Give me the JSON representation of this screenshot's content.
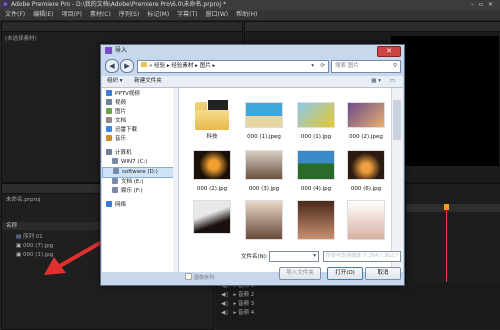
{
  "app": {
    "title": "Adobe Premiere Pro - D:\\我的文档\\Adobe\\Premiere Pro\\6.0\\未命名.prproj *",
    "logo": "Pr",
    "menu": [
      "文件(F)",
      "编辑(E)",
      "项目(P)",
      "素材(C)",
      "序列(S)",
      "标记(M)",
      "字幕(T)",
      "窗口(W)",
      "帮助(H)"
    ]
  },
  "source_panel": {
    "label": "(未选择素材)"
  },
  "project_panel": {
    "project_name": "未命名.prproj",
    "column_header": "名称",
    "items": [
      {
        "name": "序列 01",
        "icon": "sequence-icon"
      },
      {
        "name": "000 (7).jpg",
        "icon": "image-icon"
      },
      {
        "name": "000 (1).jpg",
        "icon": "image-icon"
      }
    ]
  },
  "timeline": {
    "tracks": [
      "音频 1",
      "音频 2",
      "音频 3",
      "音频 4"
    ]
  },
  "import_dialog": {
    "title": "导入",
    "close": "✕",
    "breadcrumb": [
      "«",
      "经验",
      "经验素材",
      "图片"
    ],
    "search_placeholder": "搜索 图片",
    "toolbar": {
      "organize": "组织 ▾",
      "new_folder": "新建文件夹"
    },
    "sidebar": [
      {
        "label": "PPTV视频",
        "color": "#3a7dd8"
      },
      {
        "label": "视频",
        "color": "#6b7f99"
      },
      {
        "label": "图片",
        "color": "#6b9f4a"
      },
      {
        "label": "文档",
        "color": "#8a8a8a"
      },
      {
        "label": "迅雷下载",
        "color": "#3a8ad8"
      },
      {
        "label": "音乐",
        "color": "#d08a2a"
      },
      {
        "label": "计算机",
        "color": "#6b7f99"
      },
      {
        "label": "WIN7 (C:)",
        "color": "#7a8aa8"
      },
      {
        "label": "software (D:)",
        "color": "#7a8aa8"
      },
      {
        "label": "文档 (E:)",
        "color": "#7a8aa8"
      },
      {
        "label": "娱乐 (F:)",
        "color": "#7a8aa8"
      },
      {
        "label": "网络",
        "color": "#3a7dd8"
      }
    ],
    "files": [
      {
        "name": "科技",
        "kind": "folder"
      },
      {
        "name": "000 (1).jpeg",
        "kind": "image",
        "c1": "#3fa6d8",
        "c2": "#e8d6a0"
      },
      {
        "name": "000 (1).jpg",
        "kind": "image",
        "c1": "#8ac8e8",
        "c2": "#e6c830"
      },
      {
        "name": "000 (2).jpeg",
        "kind": "image",
        "c1": "#6a4a8a",
        "c2": "#e8b070"
      },
      {
        "name": "000 (2).jpg",
        "kind": "image",
        "c1": "#1a1008",
        "c2": "#f0a030"
      },
      {
        "name": "000 (3).jpg",
        "kind": "image",
        "c1": "#d8d0c4",
        "c2": "#6a5040"
      },
      {
        "name": "000 (4).jpg",
        "kind": "image",
        "c1": "#3a8ac8",
        "c2": "#2a6a2a"
      },
      {
        "name": "000 (5).jpg",
        "kind": "image",
        "c1": "#5a5a60",
        "c2": "#d8d8d8"
      },
      {
        "name": "000 (6).jpg",
        "kind": "image",
        "c1": "#2a1a10",
        "c2": "#f0a040"
      },
      {
        "name": "",
        "kind": "image",
        "c1": "#e8e8e8",
        "c2": "#1a1010"
      },
      {
        "name": "",
        "kind": "image",
        "c1": "#e8d8c8",
        "c2": "#6a4a3a"
      },
      {
        "name": "",
        "kind": "image",
        "c1": "#4a2a1a",
        "c2": "#c89070"
      },
      {
        "name": "",
        "kind": "image",
        "c1": "#ffffff",
        "c2": "#d8b0a0"
      }
    ],
    "image_sequence_label": "图像序列",
    "filename_label": "文件名(N):",
    "filename_value": "",
    "filetype_value": "所有可支持媒体 (*.264;*.3G2;*",
    "import_folder_button": "导入文件夹",
    "open_button": "打开(O)",
    "cancel_button": "取消"
  },
  "colors": {
    "annotation_arrow": "#e03030",
    "timeline_playhead": "#f0a020"
  }
}
